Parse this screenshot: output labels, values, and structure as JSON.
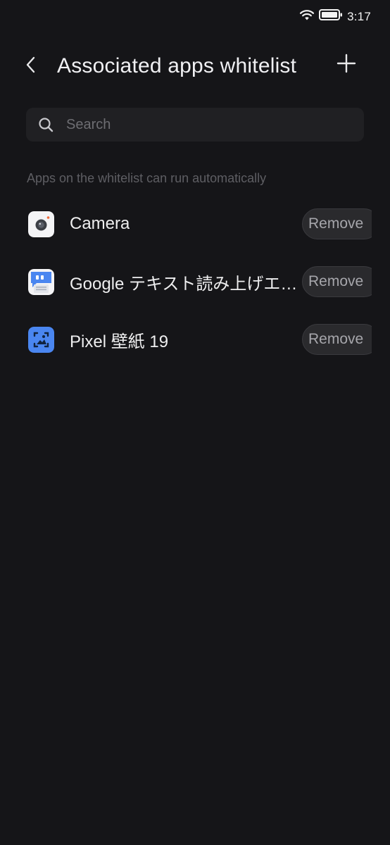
{
  "status_bar": {
    "time": "3:17",
    "icons": [
      "wifi-icon",
      "battery-icon"
    ]
  },
  "header": {
    "title": "Associated apps whitelist",
    "back_icon": "chevron-left-icon",
    "add_icon": "plus-icon"
  },
  "search": {
    "placeholder": "Search",
    "value": ""
  },
  "hint": "Apps on the whitelist can run automatically",
  "apps": [
    {
      "name": "Camera",
      "icon": "camera-app-icon",
      "action": "Remove"
    },
    {
      "name": "Google テキスト読み上げエンジン",
      "icon": "google-tts-app-icon",
      "action": "Remove"
    },
    {
      "name": "Pixel 壁紙 19",
      "icon": "pixel-wallpaper-app-icon",
      "action": "Remove"
    }
  ],
  "colors": {
    "background": "#151518",
    "search_bg": "#202023",
    "button_bg": "#2a2a2d",
    "hint_text": "#5e5e63",
    "accent_blue": "#4a86f0"
  }
}
